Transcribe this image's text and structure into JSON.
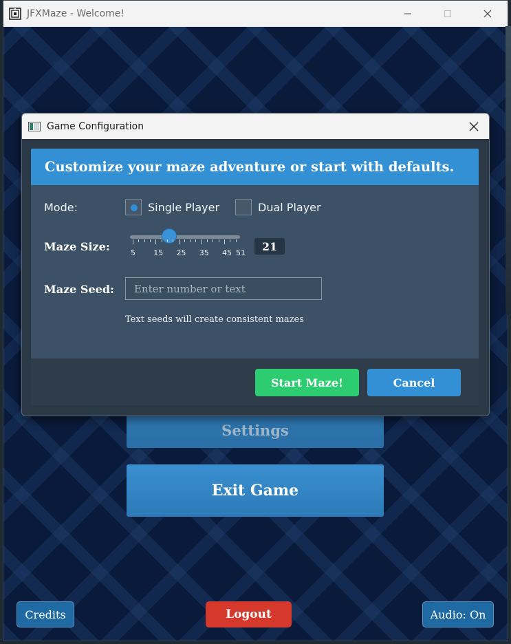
{
  "window": {
    "title": "JFXMaze - Welcome!",
    "icon": "maze-app-icon"
  },
  "menu": {
    "settings_label": "Settings",
    "exit_label": "Exit Game"
  },
  "bottom": {
    "credits_label": "Credits",
    "logout_label": "Logout",
    "audio_label": "Audio: On"
  },
  "dialog": {
    "title": "Game Configuration",
    "banner": "Customize your maze adventure or start with defaults.",
    "mode_label": "Mode:",
    "modes": [
      {
        "label": "Single Player",
        "selected": true
      },
      {
        "label": "Dual Player",
        "selected": false
      }
    ],
    "size_label": "Maze Size:",
    "size": {
      "min": 5,
      "max": 51,
      "value": 21,
      "value_text": "21",
      "tick_labels": [
        "5",
        "15",
        "25",
        "35",
        "45",
        "51"
      ]
    },
    "seed_label": "Maze Seed:",
    "seed_value": "",
    "seed_placeholder": "Enter number or text",
    "seed_hint": "Text seeds will create consistent mazes",
    "start_label": "Start Maze!",
    "cancel_label": "Cancel"
  },
  "colors": {
    "accent_blue": "#3390d4",
    "start_green": "#2ecc71",
    "logout_red": "#d5392c",
    "panel_bg": "#3d5166"
  }
}
